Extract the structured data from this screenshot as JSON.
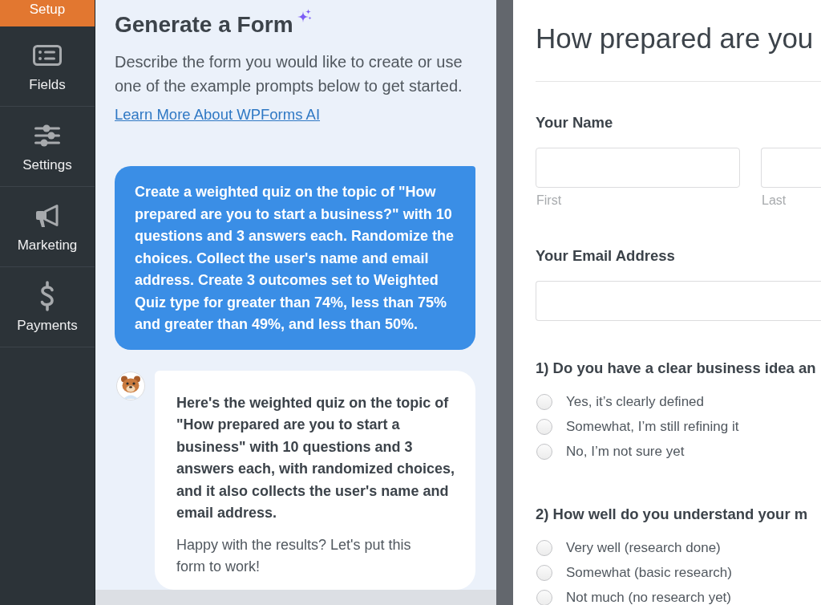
{
  "sidebar": {
    "items": [
      {
        "label": "Setup",
        "selected": true
      },
      {
        "label": "Fields",
        "selected": false
      },
      {
        "label": "Settings",
        "selected": false
      },
      {
        "label": "Marketing",
        "selected": false
      },
      {
        "label": "Payments",
        "selected": false
      }
    ]
  },
  "ai_panel": {
    "title": "Generate a Form",
    "description": "Describe the form you would like to create or use one of the example prompts below to get started.",
    "link": "Learn More About WPForms AI",
    "messages": [
      {
        "kind": "user",
        "text": "Create a weighted quiz on the topic of \"How prepared are you to start a business?\" with 10 questions and 3 answers each. Randomize the choices. Collect the user's name and email address. Create 3 outcomes set to Weighted Quiz type for greater than 74%, less than 75% and greater than 49%, and less than 50%."
      },
      {
        "kind": "assistant",
        "text": "Here's the weighted quiz on the topic of \"How prepared are you to start a business\" with 10 questions and 3 answers each, with randomized choices, and it also collects the user's name and email address.",
        "follow_up": "Happy with the results? Let's put this form to work!"
      }
    ]
  },
  "form_preview": {
    "title": "How prepared are you",
    "fields": [
      {
        "kind": "name",
        "label": "Your Name",
        "sublabels": [
          "First",
          "Last"
        ]
      },
      {
        "kind": "email",
        "label": "Your Email Address"
      },
      {
        "kind": "radio",
        "label": "1) Do you have a clear business idea an",
        "options": [
          {
            "label": "Yes, it’s clearly defined",
            "selected": false
          },
          {
            "label": "Somewhat, I’m still refining it",
            "selected": false
          },
          {
            "label": "No, I’m not sure yet",
            "selected": false
          }
        ]
      },
      {
        "kind": "radio",
        "label": "2) How well do you understand your m",
        "options": [
          {
            "label": "Very well (research done)",
            "selected": false
          },
          {
            "label": "Somewhat (basic research)",
            "selected": false
          },
          {
            "label": "Not much (no research yet)",
            "selected": false
          }
        ]
      }
    ]
  }
}
